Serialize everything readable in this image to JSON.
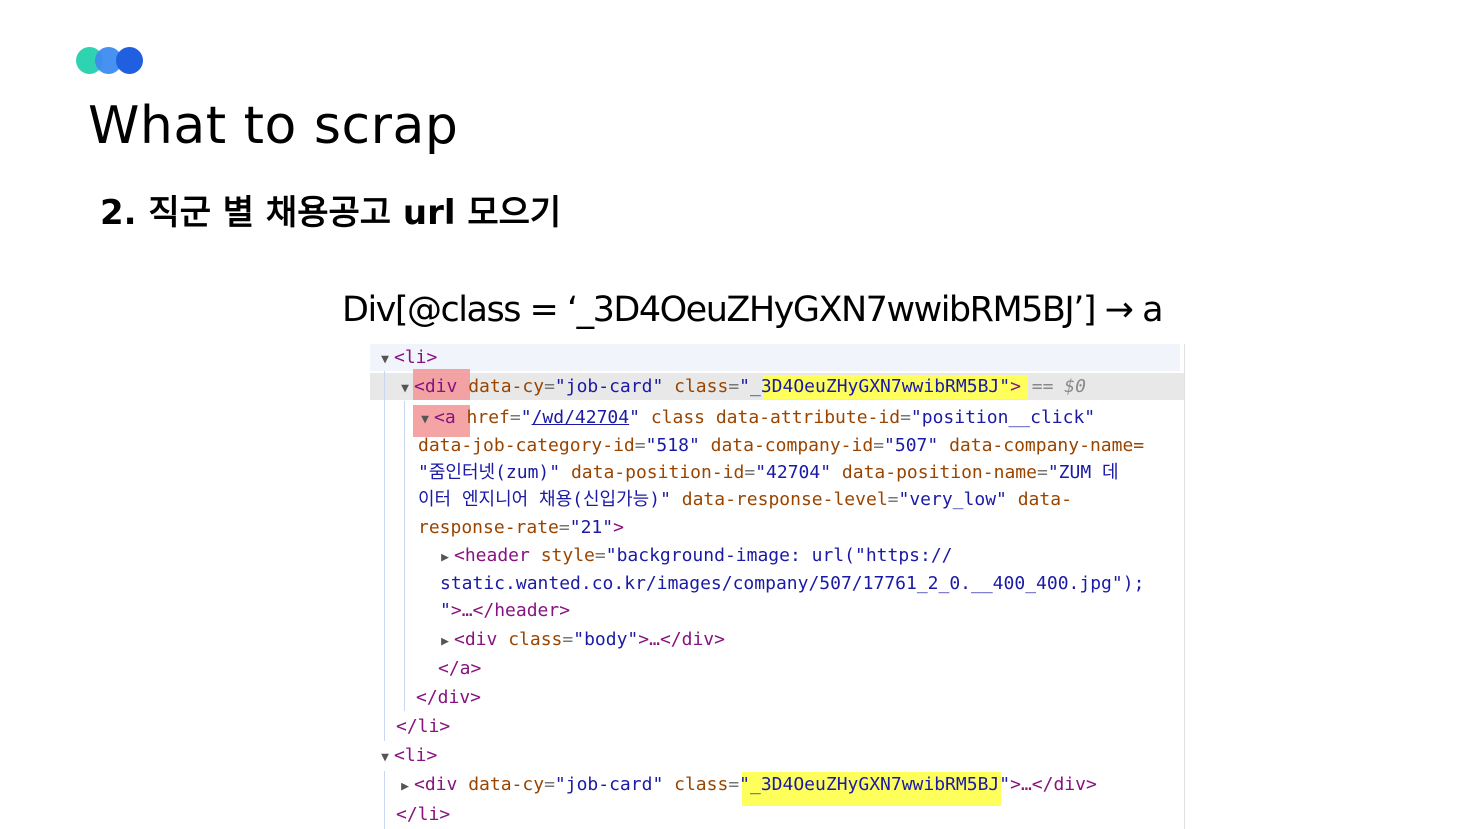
{
  "slide": {
    "title": "What to scrap",
    "subtitle": "2. 직군 별 채용공고 url 모으기",
    "xpath": "Div[@class = ‘_3D4OeuZHyGXN7wwibRM5BJ’] → a"
  },
  "colors": {
    "logo": [
      "#2fd3b2",
      "#3d8bf0",
      "#1f5fe0"
    ],
    "tag": "#881280",
    "attr_name": "#994500",
    "attr_value": "#1a1aa6",
    "highlight_red": "#f39a9a",
    "highlight_yellow": "#ffff5c"
  },
  "dom": {
    "li_open": "<li>",
    "div_tag": "<div",
    "div_cy_attr": "data-cy",
    "div_cy_val": "\"job-card\"",
    "class_attr": "class",
    "class_val": "\"_3D4OeuZHyGXN7wwibRM5BJ\"",
    "selected_marker": "== $0",
    "a_tag": "<a",
    "href_attr": "href",
    "href_val": "/wd/42704",
    "a_line1_rest_attr": "class data-attribute-id",
    "a_line1_rest_val": "\"position__click\"",
    "a_line2_attr1": "data-job-category-id",
    "a_line2_val1": "\"518\"",
    "a_line2_attr2": "data-company-id",
    "a_line2_val2": "\"507\"",
    "a_line2_attr3": "data-company-name=",
    "a_line3_val1": "\"줌인터넷(zum)\"",
    "a_line3_attr1": "data-position-id",
    "a_line3_val2": "\"42704\"",
    "a_line3_attr2": "data-position-name",
    "a_line3_val3": "\"ZUM 데",
    "a_line4_val1": "이터 엔지니어 채용(신입가능)\"",
    "a_line4_attr1": "data-response-level",
    "a_line4_val2": "\"very_low\"",
    "a_line4_attr2": "data-",
    "a_line5_attr": "response-rate",
    "a_line5_val": "\"21\"",
    "header_tag": "<header",
    "style_attr": "style",
    "header_val1": "\"background-image: url(\"https://",
    "header_val2": "static.wanted.co.kr/images/company/507/17761_2_0.__400_400.jpg\");",
    "header_val3": "\"",
    "header_close": "…</header>",
    "body_div_tag": "<div",
    "body_class_val": "\"body\"",
    "body_close": "…</div>",
    "a_close": "</a>",
    "div_close": "</div>",
    "li_close": "</li>",
    "ellipsis_close": "…</div>"
  }
}
